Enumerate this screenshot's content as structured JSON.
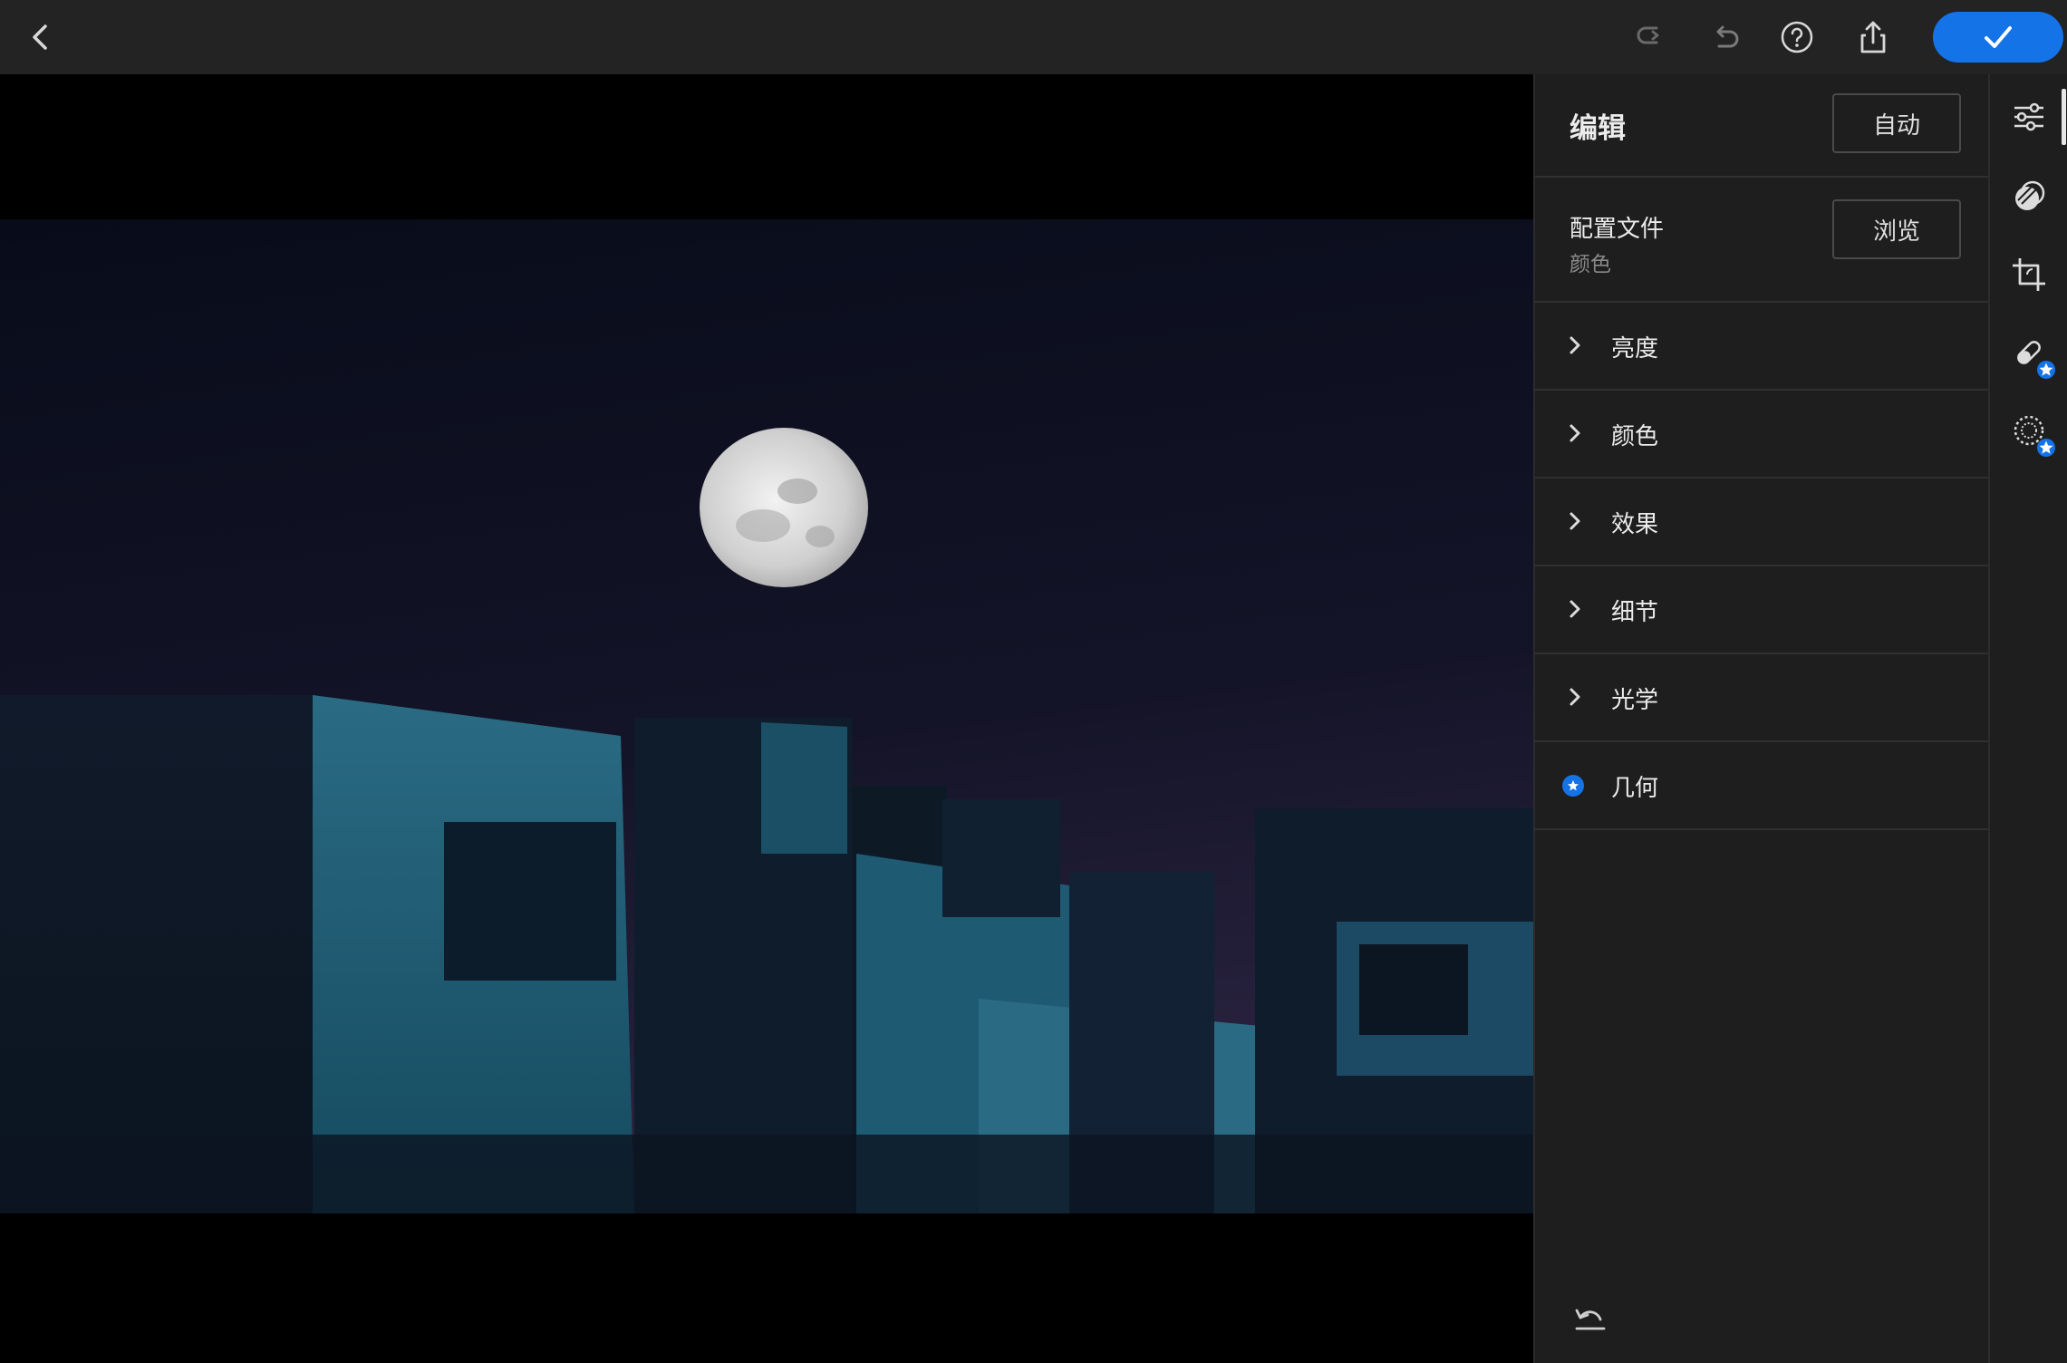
{
  "panel": {
    "title": "编辑",
    "auto_label": "自动",
    "profile": {
      "title": "配置文件",
      "subtitle": "颜色",
      "browse_label": "浏览"
    },
    "sections": [
      {
        "label": "亮度",
        "icon": "chevron-right-icon"
      },
      {
        "label": "颜色",
        "icon": "chevron-right-icon"
      },
      {
        "label": "效果",
        "icon": "chevron-right-icon"
      },
      {
        "label": "细节",
        "icon": "chevron-right-icon"
      },
      {
        "label": "光学",
        "icon": "chevron-right-icon"
      },
      {
        "label": "几何",
        "icon": "premium-star-icon"
      }
    ]
  },
  "topbar": {
    "icons": [
      "back-icon",
      "redo-icon",
      "undo-icon",
      "help-icon",
      "share-icon",
      "checkmark-icon"
    ]
  },
  "rail": {
    "tools": [
      "edit-sliders-icon",
      "masking-icon",
      "crop-icon",
      "healing-icon",
      "selective-icon"
    ],
    "active": "edit-sliders-icon"
  },
  "colors": {
    "accent": "#1473e6",
    "panel_bg": "#1e1e1e",
    "topbar_bg": "#232323"
  }
}
